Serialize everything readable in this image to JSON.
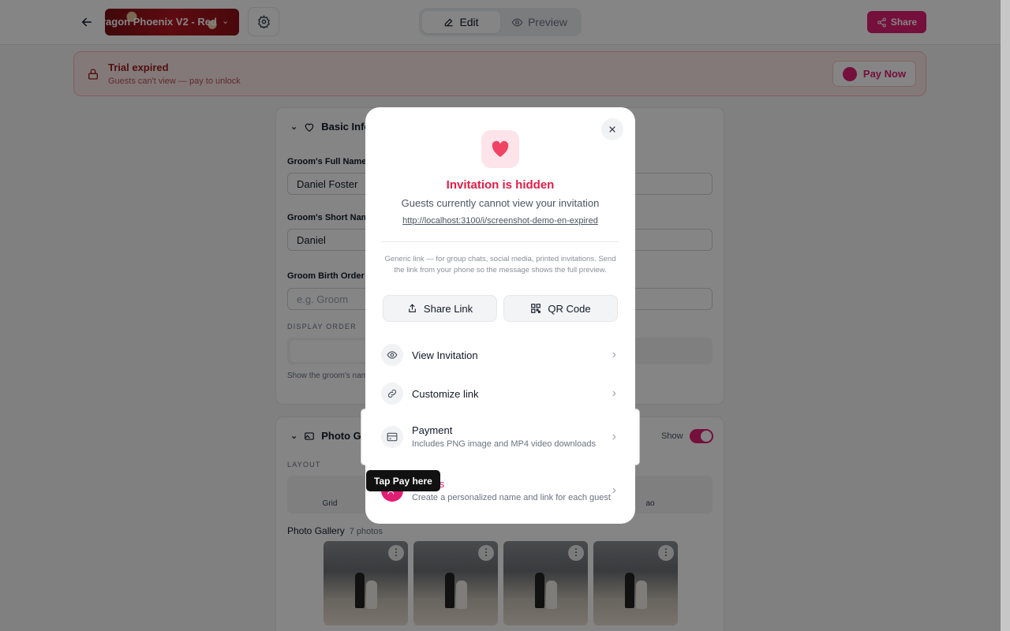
{
  "header": {
    "template_name": "ragon Phoenix V2 - Red",
    "mode_tabs": [
      {
        "label": "Edit"
      },
      {
        "label": "Preview"
      }
    ],
    "share_label": "Share"
  },
  "banner": {
    "title": "Trial expired",
    "subtitle": "Guests can't view — pay to unlock",
    "pay_now_label": "Pay Now"
  },
  "basic_info": {
    "section_title": "Basic Info",
    "groom_full_name_label": "Groom's Full Name",
    "groom_full_name_value": "Daniel Foster",
    "groom_short_name_label": "Groom's Short Name",
    "groom_short_name_value": "Daniel",
    "groom_birth_order_label": "Groom Birth Order",
    "groom_birth_order_placeholder": "e.g. Groom",
    "display_order_label": "DISPLAY ORDER",
    "display_order_options": [
      "Groom",
      "rst"
    ],
    "display_order_hint": "Show the groom's nam"
  },
  "photo_gallery": {
    "section_title": "Photo Gal",
    "show_label": "Show",
    "layout_label": "LAYOUT",
    "layout_options": [
      "Grid",
      "ao"
    ],
    "gallery_title": "Photo Gallery",
    "photo_count": "7 photos"
  },
  "modal": {
    "title": "Invitation is hidden",
    "subtitle": "Guests currently cannot view your invitation",
    "link": "http://localhost:3100/i/screenshot-demo-en-expired",
    "note": "Generic link — for group chats, social media, printed invitations. Send the link from your phone so the message shows the full preview.",
    "share_link_label": "Share Link",
    "qr_code_label": "QR Code",
    "rows": [
      {
        "title": "View Invitation",
        "subtitle": ""
      },
      {
        "title": "Customize link",
        "subtitle": ""
      },
      {
        "title": "Payment",
        "subtitle": "Includes PNG image and MP4 video downloads"
      },
      {
        "title": "Guests",
        "subtitle": "Create a personalized name and link for each guest"
      }
    ]
  },
  "tooltip": {
    "text": "Tap Pay here"
  },
  "colors": {
    "accent": "#e11d74",
    "danger": "#e11d48",
    "banner_bg": "#fde8e8"
  }
}
